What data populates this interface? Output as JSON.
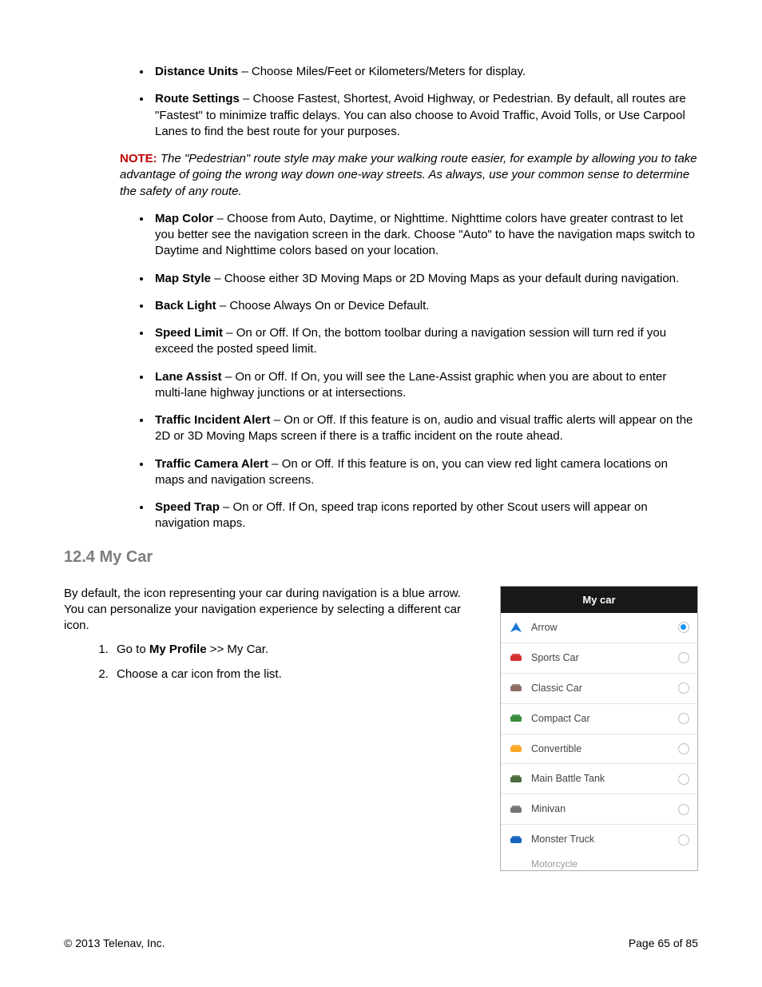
{
  "bullets_top": [
    {
      "term": "Distance Units",
      "desc": " – Choose Miles/Feet or Kilometers/Meters for display."
    },
    {
      "term": "Route Settings",
      "desc": " – Choose Fastest, Shortest, Avoid Highway, or Pedestrian. By default, all routes are \"Fastest\" to minimize traffic delays. You can also choose to Avoid Traffic, Avoid Tolls, or Use Carpool Lanes to find the best route for your purposes."
    }
  ],
  "note_label": "NOTE:",
  "note_text": " The \"Pedestrian\" route style may make your walking route easier, for example by allowing you to take advantage of going the wrong way down one-way streets. As always, use your common sense to determine the safety of any route.",
  "bullets_bottom": [
    {
      "term": "Map Color",
      "desc": " – Choose from Auto, Daytime, or Nighttime. Nighttime colors have greater contrast to let you better see the navigation screen in the dark. Choose \"Auto\" to have the navigation maps switch to Daytime and Nighttime colors based on your location."
    },
    {
      "term": "Map Style",
      "desc": " – Choose either 3D Moving Maps or 2D Moving Maps as your default during navigation."
    },
    {
      "term": "Back Light",
      "desc": " – Choose Always On or Device Default."
    },
    {
      "term": "Speed Limit",
      "desc": " – On or Off. If On, the bottom toolbar during a navigation session will turn red if you exceed the posted speed limit."
    },
    {
      "term": "Lane Assist",
      "desc": " – On or Off. If On, you will see the Lane-Assist graphic when you are about to enter multi-lane highway junctions or at intersections."
    },
    {
      "term": "Traffic Incident Alert",
      "desc": " – On or Off. If this feature is on, audio and visual traffic alerts will appear on the 2D or 3D Moving Maps screen if there is a traffic incident on the route ahead."
    },
    {
      "term": "Traffic Camera Alert",
      "desc": " – On or Off. If this feature is on, you can view red light camera locations on maps and navigation screens."
    },
    {
      "term": "Speed Trap",
      "desc": " – On or Off. If On, speed trap icons reported by other Scout users will appear on navigation maps."
    }
  ],
  "section_heading": "12.4 My Car",
  "intro": "By default, the icon representing your car during navigation is a blue arrow. You can personalize your navigation experience by selecting a different car icon.",
  "steps": {
    "one_a": "Go to ",
    "one_b": "My Profile",
    "one_c": " >> My Car.",
    "two": "Choose a car icon from the list."
  },
  "phone": {
    "header": "My car",
    "items": [
      {
        "label": "Arrow",
        "color": "#1976d2",
        "selected": true
      },
      {
        "label": "Sports Car",
        "color": "#d32f2f",
        "selected": false
      },
      {
        "label": "Classic Car",
        "color": "#8d6e63",
        "selected": false
      },
      {
        "label": "Compact Car",
        "color": "#388e3c",
        "selected": false
      },
      {
        "label": "Convertible",
        "color": "#f9a825",
        "selected": false
      },
      {
        "label": "Main Battle Tank",
        "color": "#4b6b3c",
        "selected": false
      },
      {
        "label": "Minivan",
        "color": "#757575",
        "selected": false
      },
      {
        "label": "Monster Truck",
        "color": "#1565c0",
        "selected": false
      }
    ],
    "peek": "Motorcycle"
  },
  "footer_left": "© 2013 Telenav, Inc.",
  "footer_right": "Page 65 of 85"
}
